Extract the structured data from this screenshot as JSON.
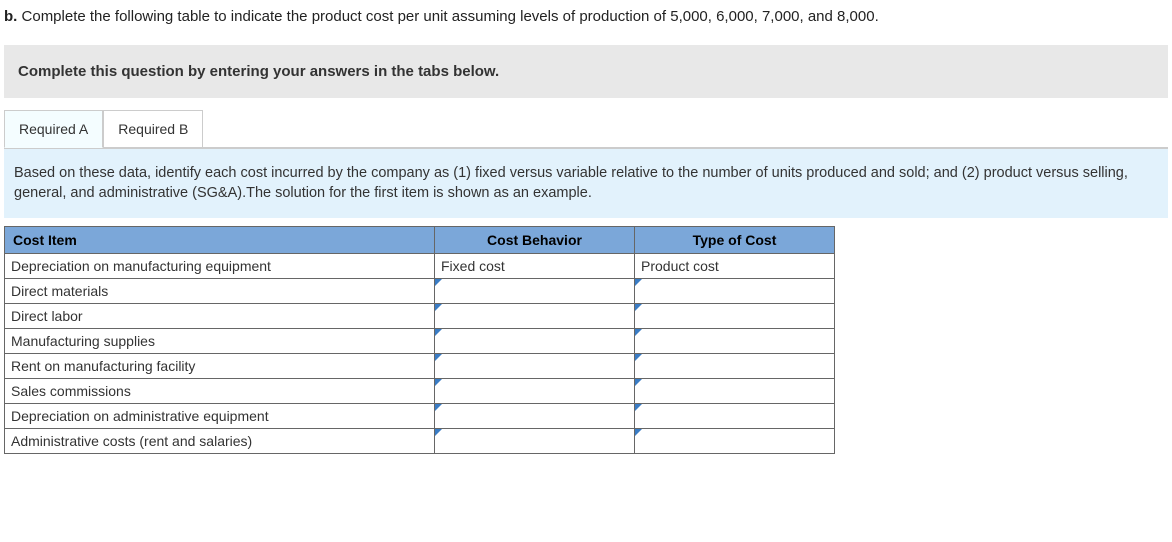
{
  "prompt": {
    "label": "b.",
    "text": "Complete the following table to indicate the product cost per unit assuming levels of production of 5,000, 6,000, 7,000, and 8,000."
  },
  "instruction": "Complete this question by entering your answers in the tabs below.",
  "tabs": [
    {
      "label": "Required A",
      "active": true
    },
    {
      "label": "Required B",
      "active": false
    }
  ],
  "description": "Based on these data, identify each cost incurred by the company as (1) fixed versus variable relative to the number of units produced and sold; and (2) product versus selling, general, and administrative (SG&A).The solution for the first item is shown as an example.",
  "table": {
    "headers": {
      "cost_item": "Cost Item",
      "cost_behavior": "Cost Behavior",
      "type_of_cost": "Type of Cost"
    },
    "rows": [
      {
        "label": "Depreciation on manufacturing equipment",
        "behavior": "Fixed cost",
        "type": "Product cost",
        "has_dropdown": false
      },
      {
        "label": "Direct materials",
        "behavior": "",
        "type": "",
        "has_dropdown": true
      },
      {
        "label": "Direct labor",
        "behavior": "",
        "type": "",
        "has_dropdown": true
      },
      {
        "label": "Manufacturing supplies",
        "behavior": "",
        "type": "",
        "has_dropdown": true
      },
      {
        "label": "Rent on manufacturing facility",
        "behavior": "",
        "type": "",
        "has_dropdown": true
      },
      {
        "label": "Sales commissions",
        "behavior": "",
        "type": "",
        "has_dropdown": true
      },
      {
        "label": "Depreciation on administrative equipment",
        "behavior": "",
        "type": "",
        "has_dropdown": true
      },
      {
        "label": "Administrative costs (rent and salaries)",
        "behavior": "",
        "type": "",
        "has_dropdown": true
      }
    ]
  }
}
